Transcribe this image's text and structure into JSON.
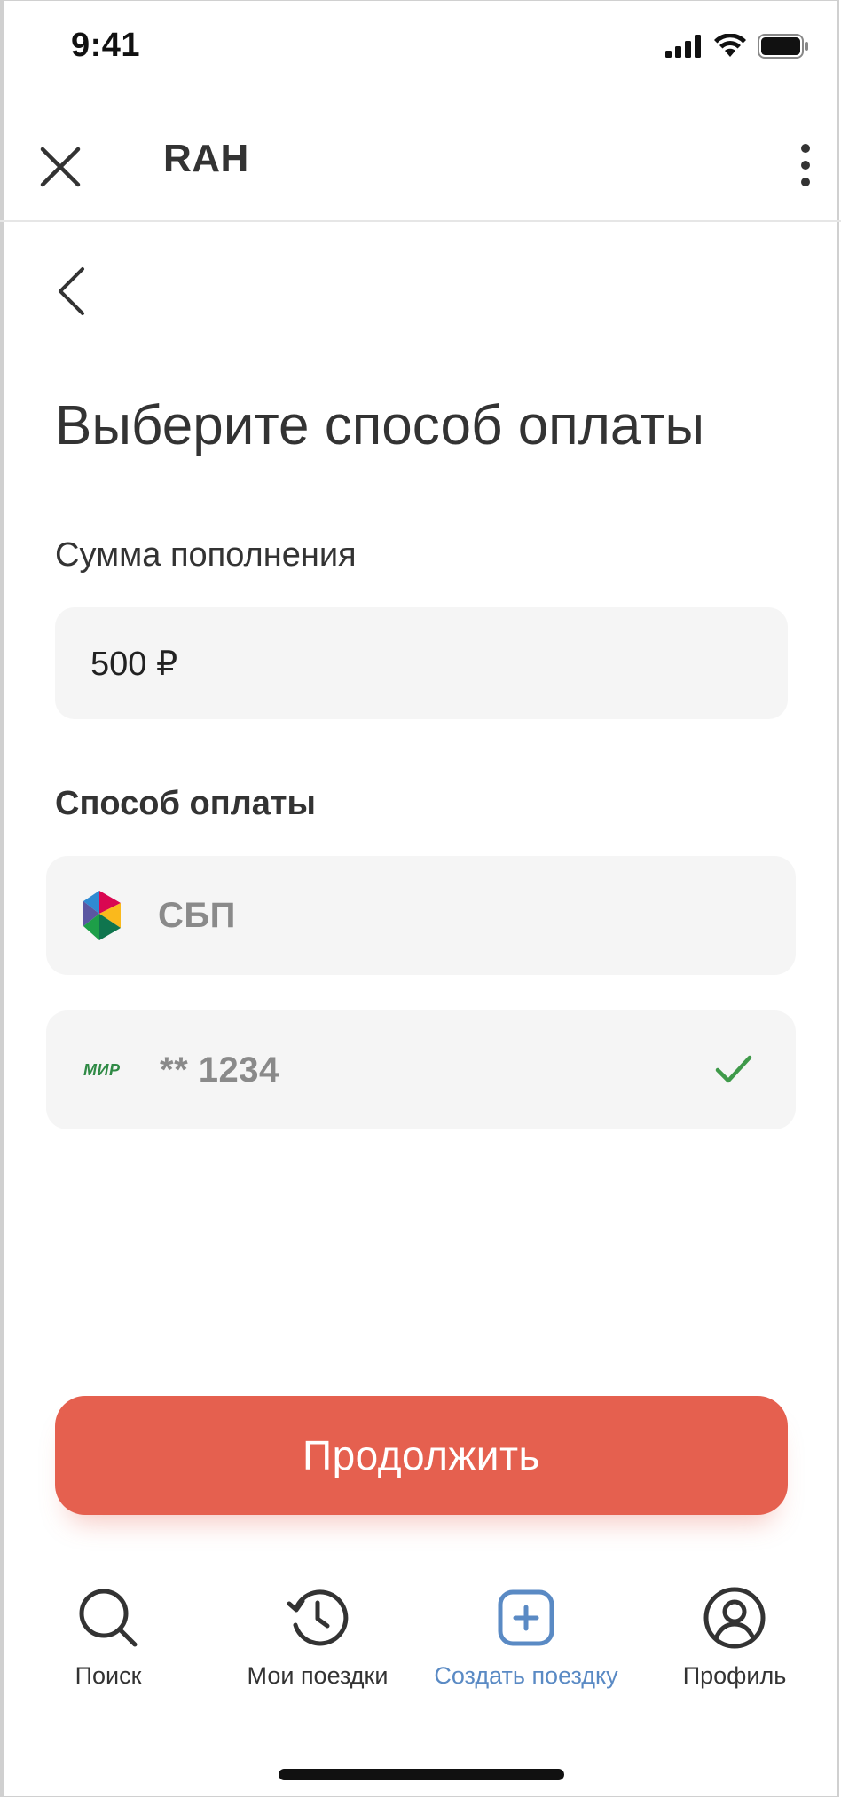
{
  "status_bar": {
    "time": "9:41"
  },
  "header": {
    "title": "RAH"
  },
  "page": {
    "title": "Выберите способ оплаты",
    "amount_label": "Сумма пополнения",
    "amount_value": "500 ₽",
    "method_label": "Способ оплаты"
  },
  "payment_methods": [
    {
      "label": "СБП",
      "icon": "sbp-logo-icon",
      "selected": false
    },
    {
      "label": "** 1234",
      "icon": "mir-logo-icon",
      "logo_text": "МИР",
      "selected": true
    }
  ],
  "actions": {
    "continue_label": "Продолжить"
  },
  "bottom_nav": {
    "items": [
      {
        "label": "Поиск",
        "icon": "search-icon"
      },
      {
        "label": "Мои поездки",
        "icon": "history-icon"
      },
      {
        "label": "Создать поездку",
        "icon": "plus-square-icon",
        "active": true
      },
      {
        "label": "Профиль",
        "icon": "profile-icon"
      }
    ]
  },
  "colors": {
    "primary_button": "#e5604f",
    "active_nav": "#5a8ac4",
    "check": "#3f9a4a",
    "field_bg": "#f5f5f5"
  }
}
